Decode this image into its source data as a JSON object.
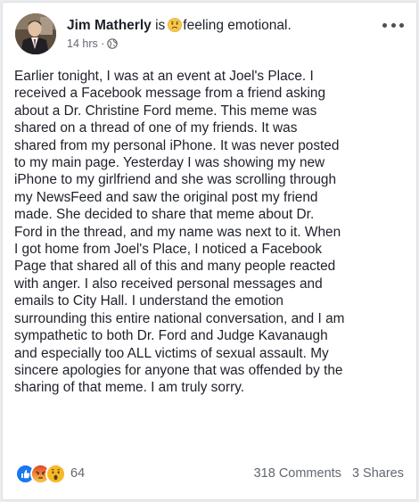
{
  "post": {
    "author": "Jim Matherly",
    "verb": "is",
    "feeling_icon": "sad-face-icon",
    "feeling": "feeling emotional.",
    "timestamp": "14 hrs",
    "separator": "·",
    "audience_icon": "globe-icon",
    "more_icon": "more-options-icon",
    "body_lines": [
      "Earlier tonight, I was at an event at Joel's Place.  I",
      "received a Facebook message from a friend asking",
      "about a Dr. Christine Ford meme.  This meme was",
      "shared on a thread of one of my friends.  It was",
      "shared from my personal iPhone.  It was never posted",
      "to my main page.  Yesterday I was showing my new",
      "iPhone to my girlfriend and she was scrolling through",
      "my NewsFeed and saw the original post my friend",
      "made.  She decided to share that meme about Dr.",
      "Ford in the thread, and my name was next to it.  When",
      "I got home from Joel's Place, I noticed a Facebook",
      "Page that shared all of this and many people reacted",
      "with anger.  I also received personal messages and",
      "emails to City Hall.  I understand the emotion",
      "surrounding this entire national conversation, and I am",
      "sympathetic to both Dr. Ford and Judge Kavanaugh",
      "and especially too ALL victims of sexual assault.  My",
      "sincere apologies for anyone that was offended by the",
      "sharing of that meme.  I am truly sorry."
    ],
    "reactions": {
      "icons": [
        "like-icon",
        "angry-icon",
        "wow-icon"
      ],
      "count": "64"
    },
    "comments": "318 Comments",
    "shares": "3 Shares"
  },
  "colors": {
    "like_blue": "#1877f2",
    "angry_orange": "#e9710f",
    "wow_yellow": "#f7b928",
    "meta_gray": "#616770"
  }
}
